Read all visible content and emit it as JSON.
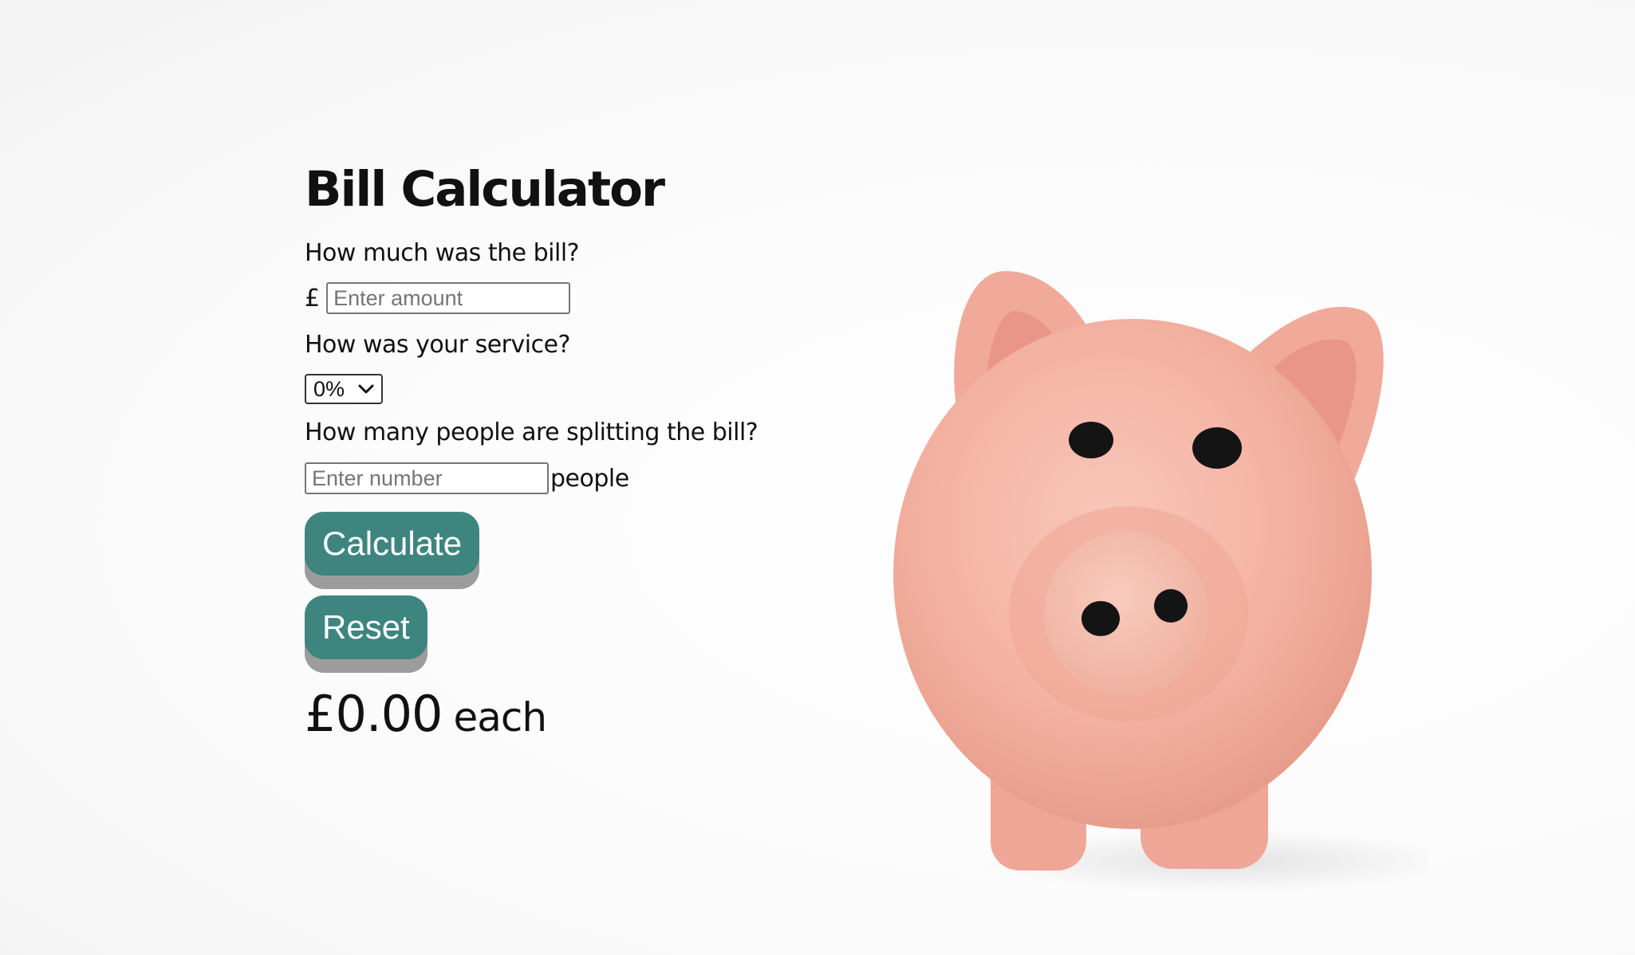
{
  "app": {
    "title": "Bill Calculator"
  },
  "bill": {
    "question": "How much was the bill?",
    "currency_symbol": "£",
    "placeholder": "Enter amount",
    "value": ""
  },
  "service": {
    "question": "How was your service?",
    "selected": "0%"
  },
  "people": {
    "question": "How many people are splitting the bill?",
    "placeholder": "Enter number",
    "value": "",
    "unit": "people"
  },
  "buttons": {
    "calculate": "Calculate",
    "reset": "Reset"
  },
  "result": {
    "amount": "£0.00",
    "suffix": "each"
  },
  "colors": {
    "button_bg": "#3e8580",
    "button_shadow": "#9c9c9c",
    "pig_body": "#f4b5a6"
  },
  "images": {
    "hero": "piggy-bank-photo"
  }
}
